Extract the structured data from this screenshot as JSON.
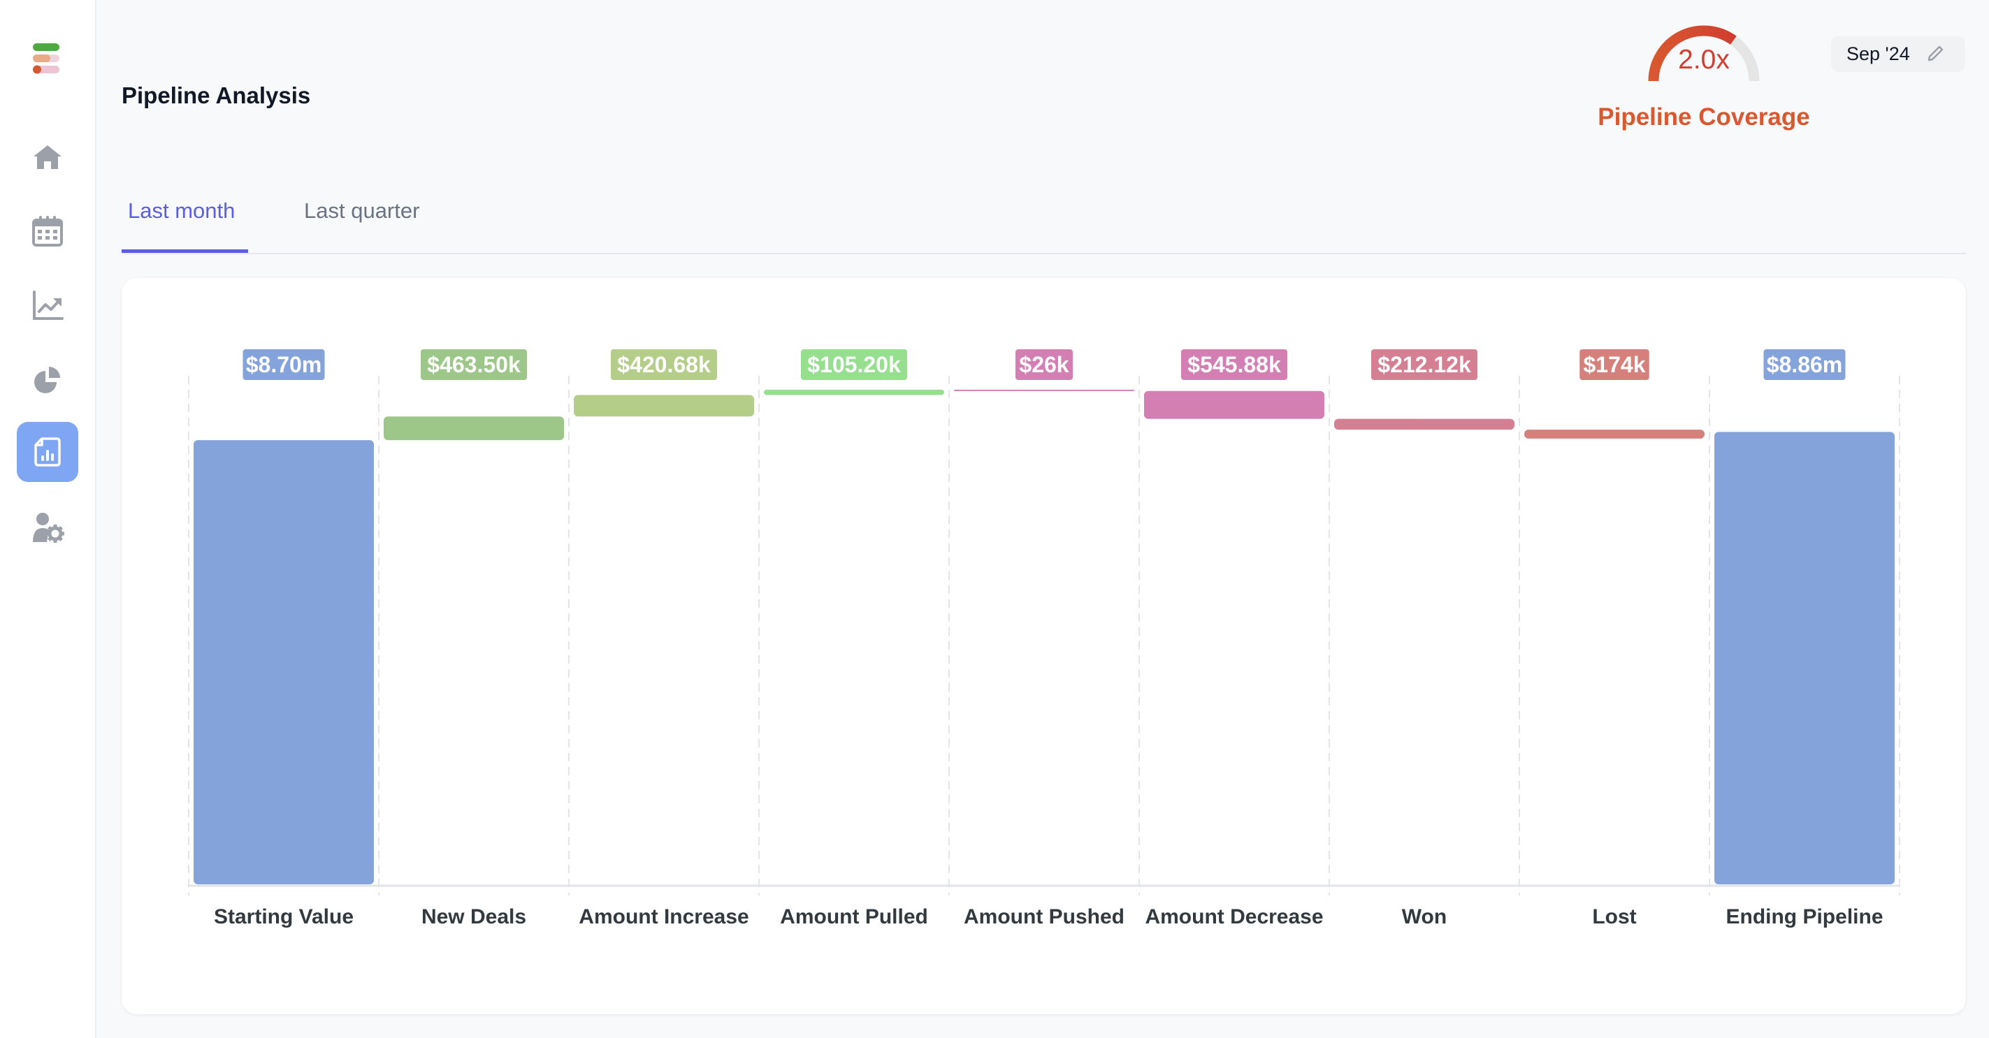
{
  "sidebar": {
    "logo": "app-logo",
    "items": [
      {
        "id": "home",
        "icon": "home-icon",
        "active": false
      },
      {
        "id": "calendar",
        "icon": "calendar-icon",
        "active": false
      },
      {
        "id": "trends",
        "icon": "trend-chart-icon",
        "active": false
      },
      {
        "id": "pie",
        "icon": "pie-chart-icon",
        "active": false
      },
      {
        "id": "reports",
        "icon": "report-icon",
        "active": true
      },
      {
        "id": "user-settings",
        "icon": "user-settings-icon",
        "active": false
      }
    ]
  },
  "header": {
    "title": "Pipeline Analysis",
    "coverage": {
      "value_label": "2.0x",
      "label": "Pipeline Coverage",
      "fill_fraction": 0.7,
      "colors": {
        "fill_start": "#d9582f",
        "fill_end": "#d13d2f",
        "track": "#e5e5e5"
      }
    },
    "period": {
      "label": "Sep '24",
      "icon": "pencil-icon"
    }
  },
  "tabs": [
    {
      "label": "Last month",
      "active": true
    },
    {
      "label": "Last quarter",
      "active": false
    }
  ],
  "chart_data": {
    "type": "bar",
    "subtype": "waterfall",
    "title": "",
    "xlabel": "",
    "ylabel": "",
    "ylim": [
      0,
      10.07
    ],
    "unit": "$m",
    "grid": "vertical-dashed",
    "categories": [
      "Starting Value",
      "New Deals",
      "Amount Increase",
      "Amount Pulled",
      "Amount Pushed",
      "Amount Decrease",
      "Won",
      "Lost",
      "Ending Pipeline"
    ],
    "values": [
      8.7,
      0.4635,
      0.42068,
      0.1052,
      -0.026,
      -0.54588,
      -0.21212,
      -0.174,
      8.86
    ],
    "kinds": [
      "total",
      "delta",
      "delta",
      "delta",
      "delta",
      "delta",
      "delta",
      "delta",
      "total"
    ],
    "labels": [
      "$8.70m",
      "$463.50k",
      "$420.68k",
      "$105.20k",
      "$26k",
      "$545.88k",
      "$212.12k",
      "$174k",
      "$8.86m"
    ],
    "colors": [
      "#84a3db",
      "#9dc788",
      "#b4cd88",
      "#95df8f",
      "#d47fb4",
      "#d47fb4",
      "#d47f92",
      "#d5807a",
      "#84a3db"
    ]
  }
}
